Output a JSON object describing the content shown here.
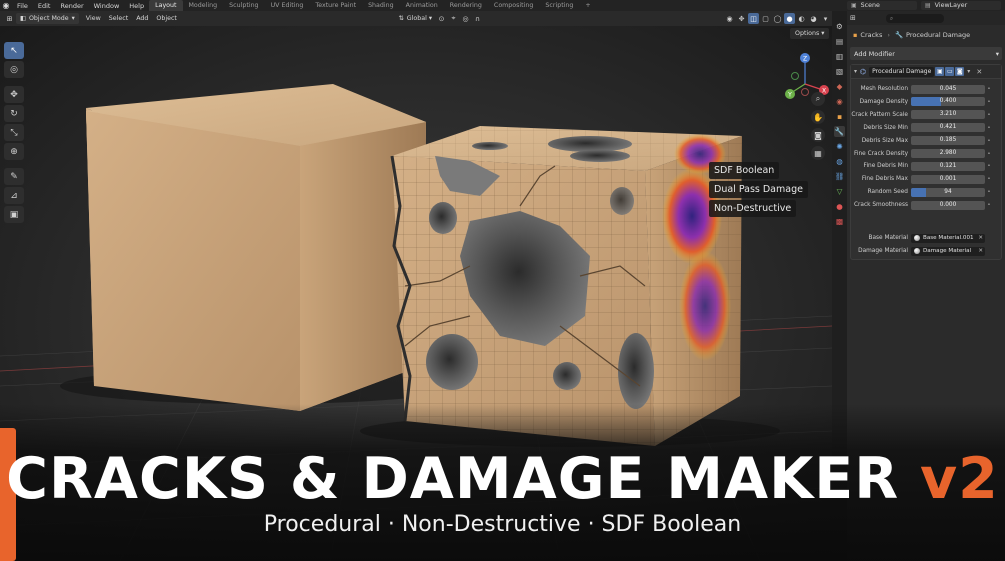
{
  "topbar": {
    "menu": [
      "File",
      "Edit",
      "Render",
      "Window",
      "Help"
    ],
    "workspaces": [
      "Layout",
      "Modeling",
      "Sculpting",
      "UV Editing",
      "Texture Paint",
      "Shading",
      "Animation",
      "Rendering",
      "Compositing",
      "Scripting"
    ],
    "active_workspace": "Layout",
    "add_workspace": "+",
    "scene_label": "Scene",
    "view_layer_label": "ViewLayer"
  },
  "viewport_header": {
    "mode": "Object Mode",
    "menus": [
      "View",
      "Select",
      "Add",
      "Object"
    ],
    "transform_orientation": "Global",
    "options_label": "Options"
  },
  "viewport": {
    "feature_labels": [
      "SDF Boolean",
      "Dual Pass Damage",
      "Non-Destructive"
    ],
    "gizmo_axes": {
      "x": "X",
      "y": "Y",
      "z": "Z"
    },
    "colors": {
      "cube": "#c9a57a",
      "heatmap_hot": "#f0b023",
      "heatmap_cold": "#3b2a8c"
    }
  },
  "properties": {
    "search_placeholder": "",
    "breadcrumb": [
      "Cracks",
      "Procedural Damage"
    ],
    "add_modifier": "Add Modifier",
    "modifier_name": "Procedural Damage",
    "params": [
      {
        "label": "Mesh Resolution",
        "value": "0.045",
        "fill": 0.0
      },
      {
        "label": "Damage Density",
        "value": "0.400",
        "fill": 0.4
      },
      {
        "label": "Crack Pattern Scale",
        "value": "3.210",
        "fill": 0.0
      },
      {
        "label": "Debris Size Min",
        "value": "0.421",
        "fill": 0.0
      },
      {
        "label": "Debris Size Max",
        "value": "0.185",
        "fill": 0.0
      },
      {
        "label": "Fine Crack Density",
        "value": "2.980",
        "fill": 0.0
      },
      {
        "label": "Fine Debris Min",
        "value": "0.121",
        "fill": 0.0
      },
      {
        "label": "Fine Debris Max",
        "value": "0.001",
        "fill": 0.0
      },
      {
        "label": "Random Seed",
        "value": "94",
        "fill": 0.2
      },
      {
        "label": "Crack Smoothness",
        "value": "0.000",
        "fill": 0.0
      }
    ],
    "base_material_label": "Base Material",
    "base_material": "Base Material.001",
    "damage_material_label": "Damage Material",
    "damage_material": "Damage Material"
  },
  "overlay": {
    "title_main": "CRACKS & DAMAGE MAKER",
    "title_version": "v2",
    "subtitle": "Procedural · Non-Destructive · SDF Boolean",
    "accent_color": "#e8642c"
  }
}
